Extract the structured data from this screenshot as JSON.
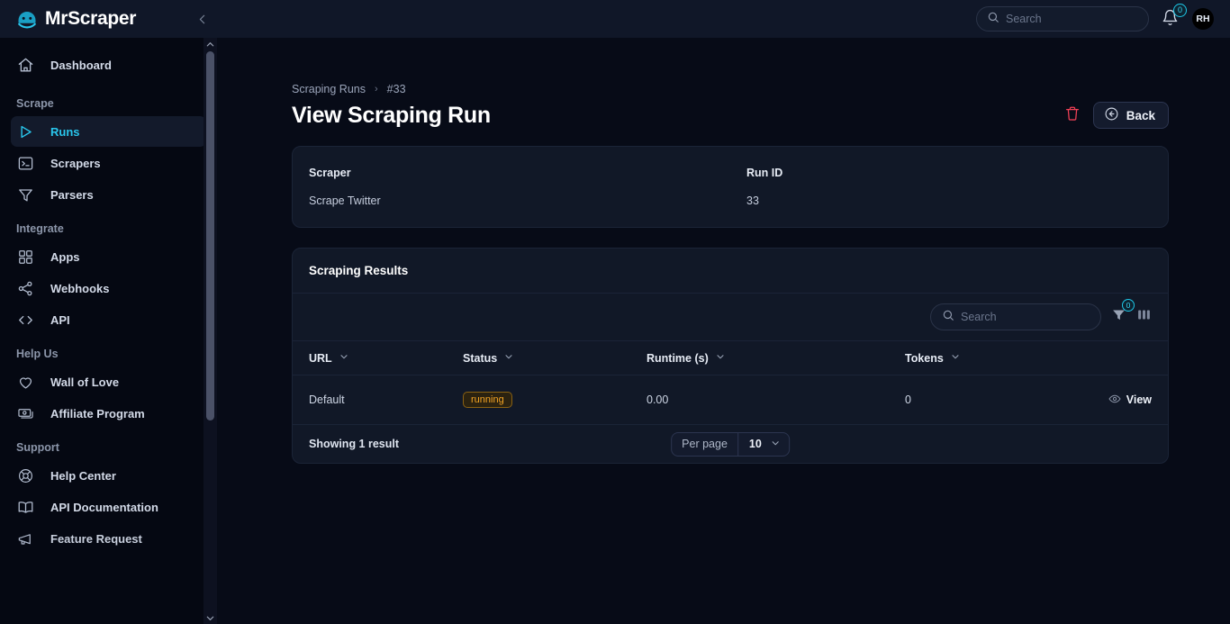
{
  "app": {
    "brand": "MrScraper",
    "logo_icon": "scraper-mask-icon",
    "collapse_icon": "chevron-left-icon"
  },
  "topbar": {
    "search_placeholder": "Search",
    "search_value": "",
    "search_icon": "search-icon",
    "bell_icon": "bell-icon",
    "notification_count": "0",
    "avatar_initials": "RH"
  },
  "sidebar": {
    "dashboard": {
      "label": "Dashboard",
      "icon": "home-icon"
    },
    "sections": [
      {
        "title": "Scrape",
        "items": [
          {
            "label": "Runs",
            "icon": "play-icon",
            "active": true
          },
          {
            "label": "Scrapers",
            "icon": "terminal-icon",
            "active": false
          },
          {
            "label": "Parsers",
            "icon": "funnel-icon",
            "active": false
          }
        ]
      },
      {
        "title": "Integrate",
        "items": [
          {
            "label": "Apps",
            "icon": "grid-icon",
            "active": false
          },
          {
            "label": "Webhooks",
            "icon": "share-nodes-icon",
            "active": false
          },
          {
            "label": "API",
            "icon": "code-icon",
            "active": false
          }
        ]
      },
      {
        "title": "Help Us",
        "items": [
          {
            "label": "Wall of Love",
            "icon": "heart-icon",
            "active": false
          },
          {
            "label": "Affiliate Program",
            "icon": "banknote-icon",
            "active": false
          }
        ]
      },
      {
        "title": "Support",
        "items": [
          {
            "label": "Help Center",
            "icon": "lifebuoy-icon",
            "active": false
          },
          {
            "label": "API Documentation",
            "icon": "book-icon",
            "active": false
          },
          {
            "label": "Feature Request",
            "icon": "megaphone-icon",
            "active": false
          }
        ]
      }
    ]
  },
  "breadcrumb": {
    "parent": "Scraping Runs",
    "separator": "›",
    "current": "#33"
  },
  "page": {
    "title": "View Scraping Run",
    "delete_icon": "trash-icon",
    "back_label": "Back",
    "back_icon": "arrow-left-circle-icon"
  },
  "info_card": {
    "scraper_label": "Scraper",
    "scraper_value": "Scrape Twitter",
    "run_id_label": "Run ID",
    "run_id_value": "33"
  },
  "results": {
    "heading": "Scraping Results",
    "search_placeholder": "Search",
    "search_value": "",
    "search_icon": "search-icon",
    "filter_icon": "filter-icon",
    "filter_count": "0",
    "columns_icon": "columns-icon",
    "headers": [
      {
        "label": "URL",
        "sort_icon": "chevron-down-icon"
      },
      {
        "label": "Status",
        "sort_icon": "chevron-down-icon"
      },
      {
        "label": "Runtime (s)",
        "sort_icon": "chevron-down-icon"
      },
      {
        "label": "Tokens",
        "sort_icon": "chevron-down-icon"
      }
    ],
    "rows": [
      {
        "url": "Default",
        "status": "running",
        "runtime": "0.00",
        "tokens": "0",
        "action_label": "View",
        "action_icon": "eye-icon"
      }
    ],
    "showing": "Showing 1 result",
    "per_page_label": "Per page",
    "per_page_value": "10",
    "per_page_icon": "chevron-down-icon"
  },
  "colors": {
    "accent": "#29c6ec",
    "page_bg": "#070b17",
    "sidebar_bg": "#050812",
    "card_bg": "#111827",
    "status_running": "#f5a524",
    "danger": "#ef4056"
  }
}
